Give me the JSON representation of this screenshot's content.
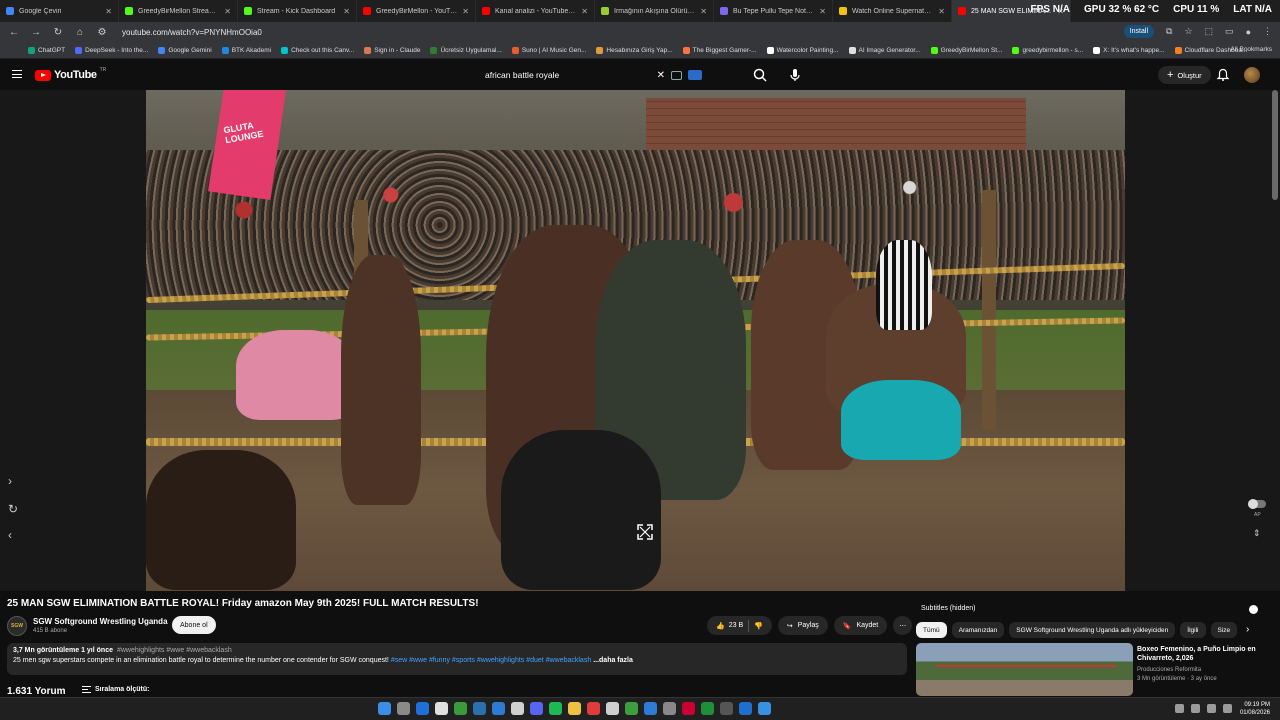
{
  "browser": {
    "tabs": [
      {
        "label": "Google Çeviri",
        "color": "#4285f4"
      },
      {
        "label": "GreedyBirMellon Stream - Watc",
        "color": "#53fc18"
      },
      {
        "label": "Stream - Kick Dashboard",
        "color": "#53fc18"
      },
      {
        "label": "GreedyBirMellon - YouTube",
        "color": "#ff0000"
      },
      {
        "label": "Kanal analizi - YouTube Studio",
        "color": "#ff0000"
      },
      {
        "label": "Irmağının Akışına Ölürüm Türk",
        "color": "#9acd32"
      },
      {
        "label": "Bu Tepe Pullu Tepe Notaları | N",
        "color": "#7b68ee"
      },
      {
        "label": "Watch Online Supernatural Sea",
        "color": "#f4c20d"
      },
      {
        "label": "25 MAN SGW ELIMINATION",
        "color": "#ff0000"
      }
    ],
    "hud": {
      "fps": "FPS N/A",
      "gpu": "GPU 32 % 62 °C",
      "cpu": "CPU 11 %",
      "lat": "LAT N/A"
    },
    "url": "youtube.com/watch?v=PNYNHmOOia0",
    "install_label": "Install",
    "bookmarks": [
      "ChatGPT",
      "DeepSeek - Into the...",
      "Google Gemini",
      "BTK Akademi",
      "Check out this Canv...",
      "Sign in - Claude",
      "Ücretsiz Uygulamal...",
      "Suno | AI Music Gen...",
      "Hesabınıza Giriş Yap...",
      "The Biggest Gamer-...",
      "Watercolor Painting...",
      "AI Image Generator...",
      "GreedyBirMellon St...",
      "greedybirmellon - s...",
      "X: It's what's happe...",
      "Cloudflare Dashboa..."
    ],
    "all_bookmarks": "All Bookmarks"
  },
  "header": {
    "logo": "YouTube",
    "region": "TR",
    "search_value": "african battle royale",
    "create_label": "Oluştur"
  },
  "video": {
    "banner_text": "GLUTA LOUNGE",
    "ap_label": "AP"
  },
  "watch": {
    "title": "25 MAN SGW ELIMINATION BATTLE ROYAL! Friday amazon May 9th 2025! FULL MATCH RESULTS!",
    "channel_name": "SGW Softground Wrestling Uganda",
    "channel_subs": "415 B abone",
    "channel_avatar_text": "SGW",
    "subscribe_label": "Abone ol",
    "like_count": "23 B",
    "share_label": "Paylaş",
    "save_label": "Kaydet",
    "desc_views": "3,7 Mn görüntüleme",
    "desc_age": "1 yıl önce",
    "desc_tags": "#wwehighlights #wwe #wwebacklash",
    "desc_text": "25 men sgw superstars compete in an elimination battle royal to determine the number one contender for SGW conquest!",
    "desc_hashtags": "#sew #wwe #funny #sports #wwehighlights #duet #wwebacklash",
    "desc_more": "...daha fazla",
    "comments_count": "1.631 Yorum",
    "sort_label": "Sıralama ölçütü:"
  },
  "sidebar": {
    "subtitles": "Subtitles (hidden)",
    "chips": [
      "Tümü",
      "Aramanızdan",
      "SGW Softground Wrestling Uganda adlı yükleyiciden",
      "İlgili",
      "Size"
    ],
    "rec": {
      "title": "Boxeo Femenino, a Puño Limpio en Chivarreto,  2,026",
      "channel": "Producciones Reformita",
      "meta": "3 Mn görüntüleme · 3 ay önce"
    }
  },
  "taskbar": {
    "time": "09:19 PM",
    "date": "01/08/2026"
  }
}
